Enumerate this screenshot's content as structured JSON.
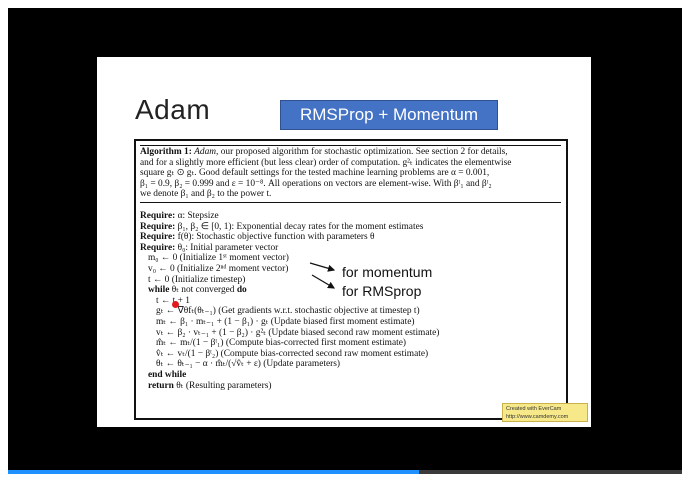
{
  "slide": {
    "title": "Adam",
    "badge": "RMSProp + Momentum"
  },
  "algorithm": {
    "header": {
      "label": "Algorithm 1:",
      "name": "Adam",
      "line1_rest": ", our proposed algorithm for stochastic optimization. See section 2 for details,",
      "line2": "and for a slightly more efficient (but less clear) order of computation. g²ₜ indicates the elementwise",
      "line3": "square gₜ ⊙ gₜ. Good default settings for the tested machine learning problems are α = 0.001,",
      "line4": "β₁ = 0.9, β₂ = 0.999 and ε = 10⁻⁸. All operations on vectors are element-wise. With βᵗ₁ and βᵗ₂",
      "line5": "we denote β₁ and β₂ to the power t."
    },
    "require_kw": "Require:",
    "requires": [
      "α: Stepsize",
      "β₁, β₂ ∈ [0, 1): Exponential decay rates for the moment estimates",
      "f(θ): Stochastic objective function with parameters θ",
      "θ₀: Initial parameter vector"
    ],
    "init": [
      "m₀ ← 0 (Initialize 1ˢᵗ moment vector)",
      "v₀ ← 0 (Initialize 2ⁿᵈ moment vector)",
      "t ← 0 (Initialize timestep)"
    ],
    "while_kw": "while",
    "while_cond": " θₜ not converged ",
    "do_kw": "do",
    "loop": [
      "t ← t + 1",
      "gₜ ← ∇θfₜ(θₜ₋₁) (Get gradients w.r.t. stochastic objective at timestep t)",
      "mₜ ← β₁ · mₜ₋₁ + (1 − β₁) · gₜ (Update biased first moment estimate)",
      "vₜ ← β₂ · vₜ₋₁ + (1 − β₂) · g²ₜ (Update biased second raw moment estimate)",
      "m̂ₜ ← mₜ/(1 − βᵗ₁) (Compute bias-corrected first moment estimate)",
      "v̂ₜ ← vₜ/(1 − βᵗ₂) (Compute bias-corrected second raw moment estimate)",
      "θₜ ← θₜ₋₁ − α · m̂ₜ/(√v̂ₜ + ε) (Update parameters)"
    ],
    "end_while": "end while",
    "return_kw": "return",
    "return_rest": " θₜ (Resulting parameters)"
  },
  "annotations": {
    "momentum": "for momentum",
    "rmsprop": "for RMSprop"
  },
  "watermark": {
    "line1": "Created with EverCam",
    "line2": "http://www.camdemy.com"
  },
  "player": {
    "progress_fraction": 0.61
  },
  "colors": {
    "badge_bg": "#4472c4",
    "progress": "#1e90ff",
    "cursor": "#e11b1b"
  }
}
